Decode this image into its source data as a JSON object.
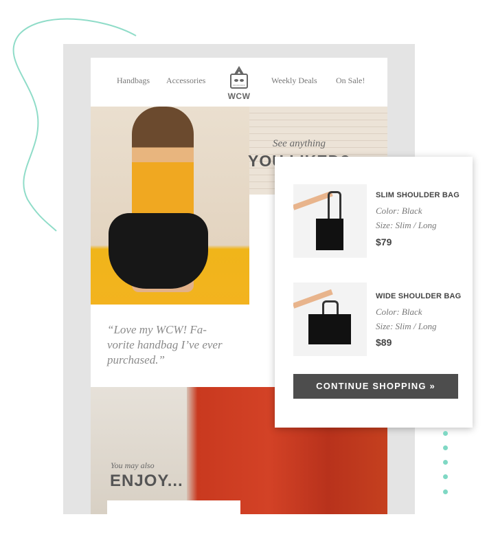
{
  "nav": {
    "items": [
      "Handbags",
      "Accessories",
      "Weekly Deals",
      "On Sale!"
    ],
    "logo_text": "WCW"
  },
  "hero": {
    "subtitle": "See anything",
    "title": "YOU LIKED?"
  },
  "testimonial": {
    "quote": "“Love my WCW! Fa-vorite handbag I’ve ever purchased.”"
  },
  "recommend": {
    "subtitle": "You may also",
    "title": "ENJOY..."
  },
  "cart": {
    "products": [
      {
        "name": "SLIM SHOULDER BAG",
        "color": "Color: Black",
        "size": "Size: Slim / Long",
        "price": "$79"
      },
      {
        "name": "WIDE SHOULDER BAG",
        "color": "Color: Black",
        "size": "Size: Slim / Long",
        "price": "$89"
      }
    ],
    "cta": "CONTINUE SHOPPING »"
  },
  "colors": {
    "accent": "#7fd8c4",
    "button": "#4d4d4d",
    "frame": "#e4e4e4"
  }
}
